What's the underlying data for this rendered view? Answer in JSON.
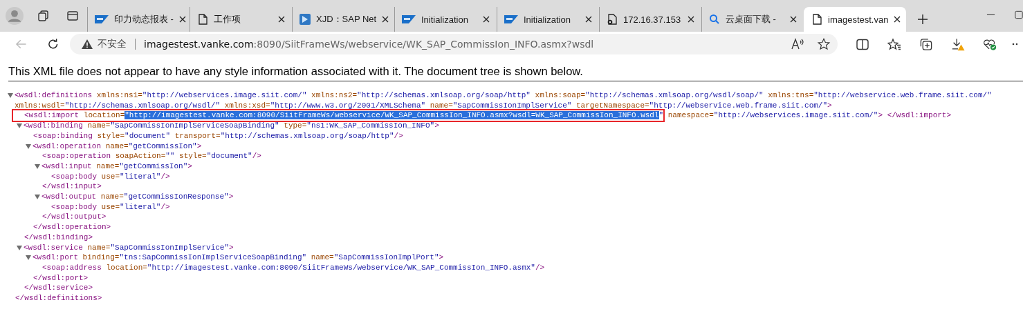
{
  "tabs": [
    {
      "title": "印力动态报表 -",
      "selected": false
    },
    {
      "title": "工作项",
      "selected": false
    },
    {
      "title": "XJD：SAP Net",
      "selected": false
    },
    {
      "title": "Initialization",
      "selected": false
    },
    {
      "title": "Initialization",
      "selected": false
    },
    {
      "title": "172.16.37.153",
      "selected": false
    },
    {
      "title": "云桌面下载 -",
      "selected": false
    },
    {
      "title": "imagestest.van",
      "selected": true
    }
  ],
  "address_bar": {
    "security": "不安全",
    "host": "imagestest.vanke.com",
    "path": ":8090/SiitFrameWs/webservice/WK_SAP_CommissIon_INFO.asmx?wsdl"
  },
  "info_message": "This XML file does not appear to have any style information associated with it. The document tree is shown below.",
  "document": {
    "expanded": true,
    "open": [
      {
        "kind": "tag",
        "text": "<wsdl:definitions"
      },
      {
        "kind": "attr",
        "text": " xmlns:ns1="
      },
      {
        "kind": "value",
        "text": "\"http://webservices.image.siit.com/\""
      },
      {
        "kind": "attr",
        "text": " xmlns:ns2="
      },
      {
        "kind": "value",
        "text": "\"http://schemas.xmlsoap.org/soap/http\""
      },
      {
        "kind": "attr",
        "text": " xmlns:soap="
      },
      {
        "kind": "value",
        "text": "\"http://schemas.xmlsoap.org/wsdl/soap/\""
      },
      {
        "kind": "attr",
        "text": " xmlns:tns="
      },
      {
        "kind": "value",
        "text": "\"http://webservice.web.frame.siit.com/\""
      },
      {
        "kind": "attr",
        "text": " xmlns:wsdl="
      },
      {
        "kind": "value",
        "text": "\"http://schemas.xmlsoap.org/wsdl/\""
      },
      {
        "kind": "attr",
        "text": " xmlns:xsd="
      },
      {
        "kind": "value",
        "text": "\"http://www.w3.org/2001/XMLSchema\""
      },
      {
        "kind": "attr",
        "text": " name="
      },
      {
        "kind": "value",
        "text": "\"SapCommissIonImplService\""
      },
      {
        "kind": "attr",
        "text": " targetNamespace="
      },
      {
        "kind": "value",
        "text": "\"http://webservice.web.frame.siit.com/\""
      },
      {
        "kind": "tag",
        "text": ">"
      }
    ],
    "close": "</wsdl:definitions>",
    "children": [
      {
        "boxed": true,
        "open": [
          {
            "kind": "tag",
            "text": "<wsdl:import"
          },
          {
            "kind": "attr",
            "text": " location="
          },
          {
            "kind": "selected",
            "text": "\"http://imagestest.vanke.com:8090/SiitFrameWs/webservice/WK_SAP_CommissIon_INFO.asmx?wsdl=WK_SAP_CommissIon_INFO.wsdl"
          },
          {
            "kind": "value",
            "text": "\""
          },
          {
            "kind": "attr",
            "text": " namespace="
          },
          {
            "kind": "value",
            "text": "\"http://webservices.image.siit.com/\""
          },
          {
            "kind": "tag",
            "text": ">"
          },
          {
            "kind": "tag",
            "text": " </wsdl:import>"
          }
        ]
      },
      {
        "expanded": true,
        "open": [
          {
            "kind": "tag",
            "text": "<wsdl:binding"
          },
          {
            "kind": "attr",
            "text": " name="
          },
          {
            "kind": "value",
            "text": "\"SapCommissIonImplServiceSoapBinding\""
          },
          {
            "kind": "attr",
            "text": " type="
          },
          {
            "kind": "value",
            "text": "\"ns1:WK_SAP_CommissIon_INFO\""
          },
          {
            "kind": "tag",
            "text": ">"
          }
        ],
        "close": "</wsdl:binding>",
        "children": [
          {
            "open": [
              {
                "kind": "tag",
                "text": "<soap:binding"
              },
              {
                "kind": "attr",
                "text": " style="
              },
              {
                "kind": "value",
                "text": "\"document\""
              },
              {
                "kind": "attr",
                "text": " transport="
              },
              {
                "kind": "value",
                "text": "\"http://schemas.xmlsoap.org/soap/http\""
              },
              {
                "kind": "tag",
                "text": "/>"
              }
            ]
          },
          {
            "expanded": true,
            "open": [
              {
                "kind": "tag",
                "text": "<wsdl:operation"
              },
              {
                "kind": "attr",
                "text": " name="
              },
              {
                "kind": "value",
                "text": "\"getCommissIon\""
              },
              {
                "kind": "tag",
                "text": ">"
              }
            ],
            "close": "</wsdl:operation>",
            "children": [
              {
                "open": [
                  {
                    "kind": "tag",
                    "text": "<soap:operation"
                  },
                  {
                    "kind": "attr",
                    "text": " soapAction="
                  },
                  {
                    "kind": "value",
                    "text": "\"\""
                  },
                  {
                    "kind": "attr",
                    "text": " style="
                  },
                  {
                    "kind": "value",
                    "text": "\"document\""
                  },
                  {
                    "kind": "tag",
                    "text": "/>"
                  }
                ]
              },
              {
                "expanded": true,
                "open": [
                  {
                    "kind": "tag",
                    "text": "<wsdl:input"
                  },
                  {
                    "kind": "attr",
                    "text": " name="
                  },
                  {
                    "kind": "value",
                    "text": "\"getCommissIon\""
                  },
                  {
                    "kind": "tag",
                    "text": ">"
                  }
                ],
                "close": "</wsdl:input>",
                "children": [
                  {
                    "open": [
                      {
                        "kind": "tag",
                        "text": "<soap:body"
                      },
                      {
                        "kind": "attr",
                        "text": " use="
                      },
                      {
                        "kind": "value",
                        "text": "\"literal\""
                      },
                      {
                        "kind": "tag",
                        "text": "/>"
                      }
                    ]
                  }
                ]
              },
              {
                "expanded": true,
                "open": [
                  {
                    "kind": "tag",
                    "text": "<wsdl:output"
                  },
                  {
                    "kind": "attr",
                    "text": " name="
                  },
                  {
                    "kind": "value",
                    "text": "\"getCommissIonResponse\""
                  },
                  {
                    "kind": "tag",
                    "text": ">"
                  }
                ],
                "close": "</wsdl:output>",
                "children": [
                  {
                    "open": [
                      {
                        "kind": "tag",
                        "text": "<soap:body"
                      },
                      {
                        "kind": "attr",
                        "text": " use="
                      },
                      {
                        "kind": "value",
                        "text": "\"literal\""
                      },
                      {
                        "kind": "tag",
                        "text": "/>"
                      }
                    ]
                  }
                ]
              }
            ]
          }
        ]
      },
      {
        "expanded": true,
        "open": [
          {
            "kind": "tag",
            "text": "<wsdl:service"
          },
          {
            "kind": "attr",
            "text": " name="
          },
          {
            "kind": "value",
            "text": "\"SapCommissIonImplService\""
          },
          {
            "kind": "tag",
            "text": ">"
          }
        ],
        "close": "</wsdl:service>",
        "children": [
          {
            "expanded": true,
            "open": [
              {
                "kind": "tag",
                "text": "<wsdl:port"
              },
              {
                "kind": "attr",
                "text": " binding="
              },
              {
                "kind": "value",
                "text": "\"tns:SapCommissIonImplServiceSoapBinding\""
              },
              {
                "kind": "attr",
                "text": " name="
              },
              {
                "kind": "value",
                "text": "\"SapCommissIonImplPort\""
              },
              {
                "kind": "tag",
                "text": ">"
              }
            ],
            "close": "</wsdl:port>",
            "children": [
              {
                "open": [
                  {
                    "kind": "tag",
                    "text": "<soap:address"
                  },
                  {
                    "kind": "attr",
                    "text": " location="
                  },
                  {
                    "kind": "value",
                    "text": "\"http://imagestest.vanke.com:8090/SiitFrameWs/webservice/WK_SAP_CommissIon_INFO.asmx\""
                  },
                  {
                    "kind": "tag",
                    "text": "/>"
                  }
                ]
              }
            ]
          }
        ]
      }
    ]
  }
}
